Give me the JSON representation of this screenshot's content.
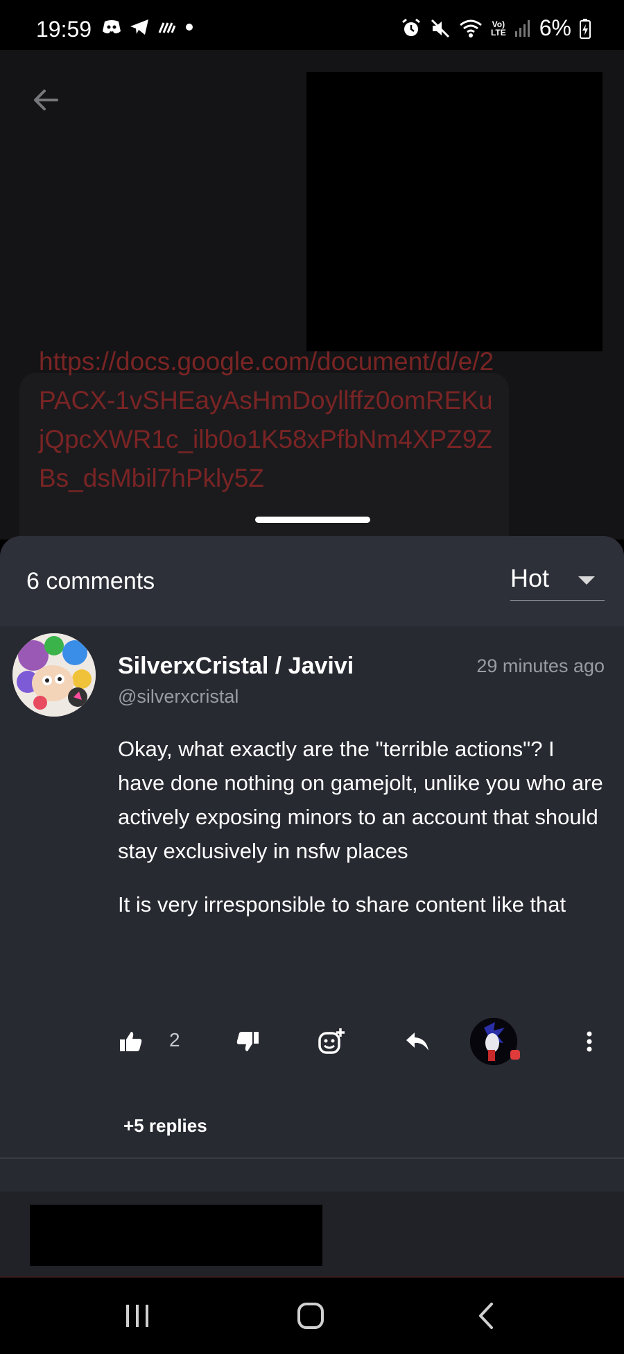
{
  "status_bar": {
    "time": "19:59",
    "battery": "6%",
    "network": "LTE",
    "icons_left": [
      "discord-icon",
      "telegram-icon",
      "signal-waves-icon",
      "dot-icon"
    ],
    "icons_right": [
      "alarm-icon",
      "mute-icon",
      "wifi-icon",
      "volte-icon",
      "cell-signal-icon",
      "battery-charging-icon"
    ]
  },
  "post": {
    "link_text": "https://docs.google.com/document/d/e/2PACX-1vSHEayAsHmDoyllffz0omREKujQpcXWR1c_ilb0o1K58xPfbNm4XPZ9ZBs_dsMbil7hPkly5Z"
  },
  "comments_sheet": {
    "count_label": "6 comments",
    "sort": {
      "selected": "Hot"
    }
  },
  "comment": {
    "author": "SilverxCristal / Javivi",
    "handle": "@silverxcristal",
    "time_ago": "29 minutes ago",
    "paragraphs": [
      "Okay, what exactly are the \"terrible actions\"? I have done nothing on gamejolt, unlike you who are actively exposing minors to an account that should stay exclusively in nsfw places",
      "It is very irresponsible to share content like that"
    ],
    "likes": "2",
    "replies_label": "+5 replies"
  },
  "colors": {
    "sheet_bg": "#282a32",
    "link_red": "#7a2424",
    "muted_text": "#9a9ca4"
  }
}
